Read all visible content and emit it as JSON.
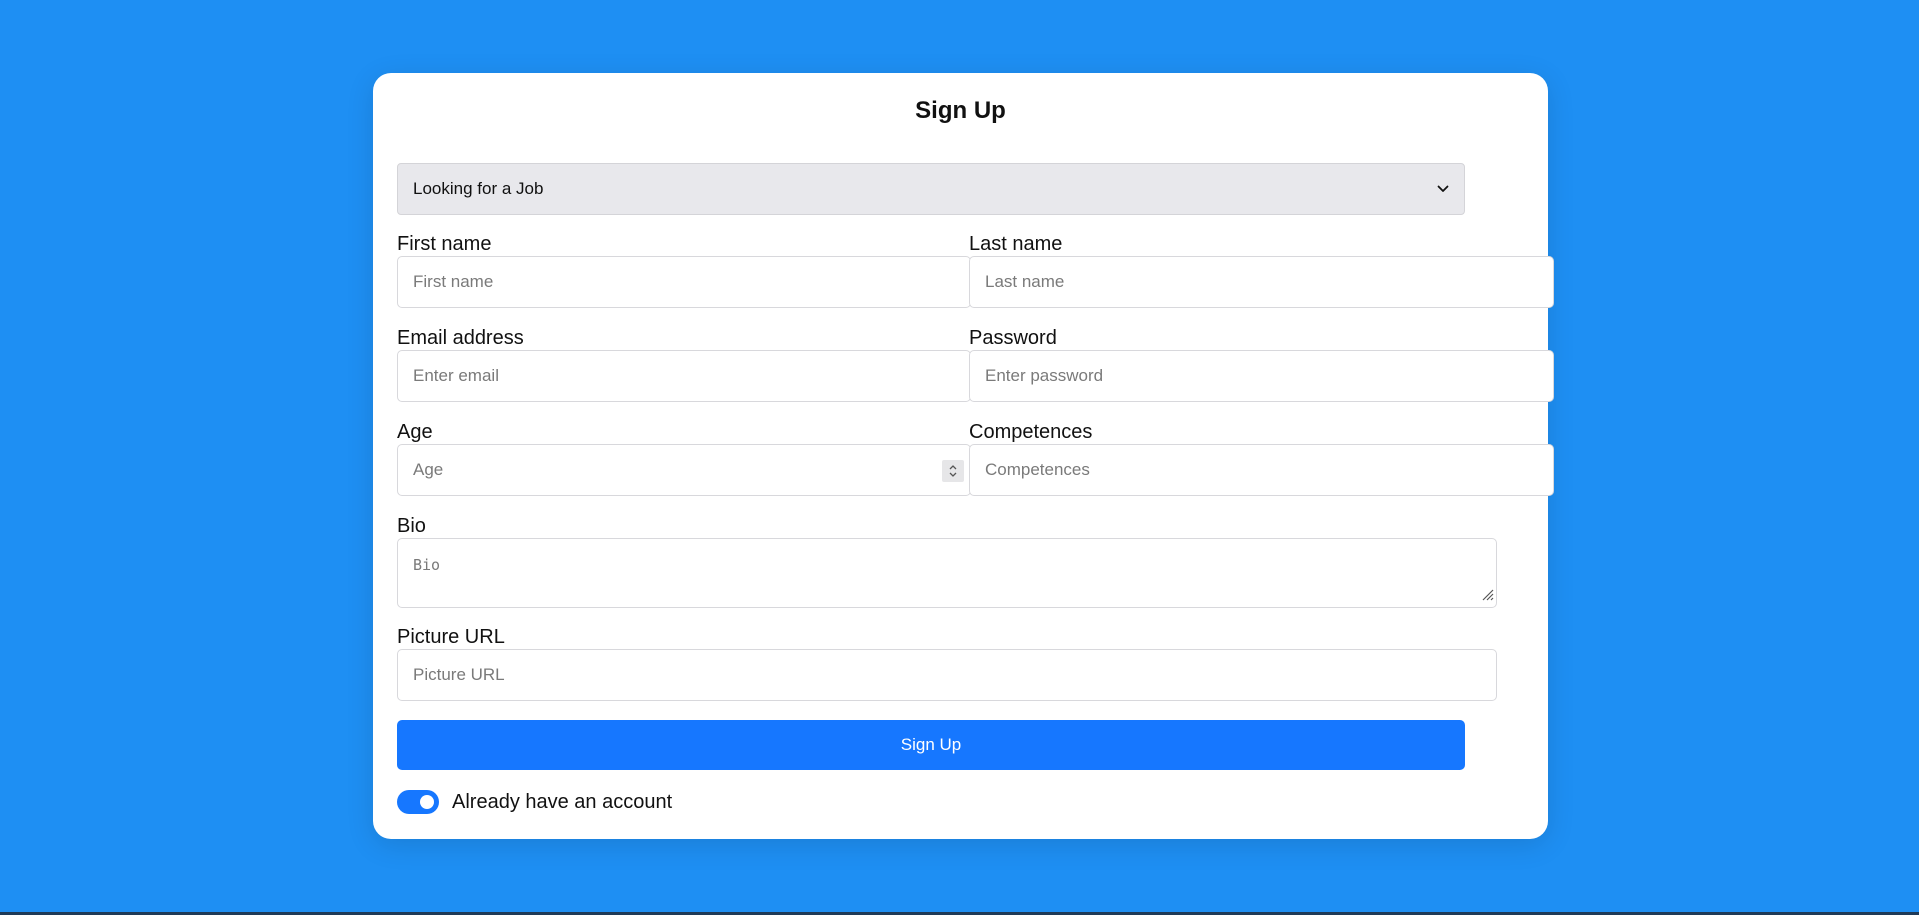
{
  "form": {
    "title": "Sign Up",
    "account_type": {
      "selected": "Looking for a Job"
    },
    "first_name": {
      "label": "First name",
      "placeholder": "First name"
    },
    "last_name": {
      "label": "Last name",
      "placeholder": "Last name"
    },
    "email": {
      "label": "Email address",
      "placeholder": "Enter email"
    },
    "password": {
      "label": "Password",
      "placeholder": "Enter password"
    },
    "age": {
      "label": "Age",
      "placeholder": "Age"
    },
    "competences": {
      "label": "Competences",
      "placeholder": "Competences"
    },
    "bio": {
      "label": "Bio",
      "placeholder": "Bio"
    },
    "picture_url": {
      "label": "Picture URL",
      "placeholder": "Picture URL"
    },
    "submit_label": "Sign Up",
    "toggle": {
      "label": "Already have an account",
      "checked": true
    }
  },
  "colors": {
    "background": "#1e8ff3",
    "accent": "#1677ff",
    "card": "#ffffff"
  }
}
